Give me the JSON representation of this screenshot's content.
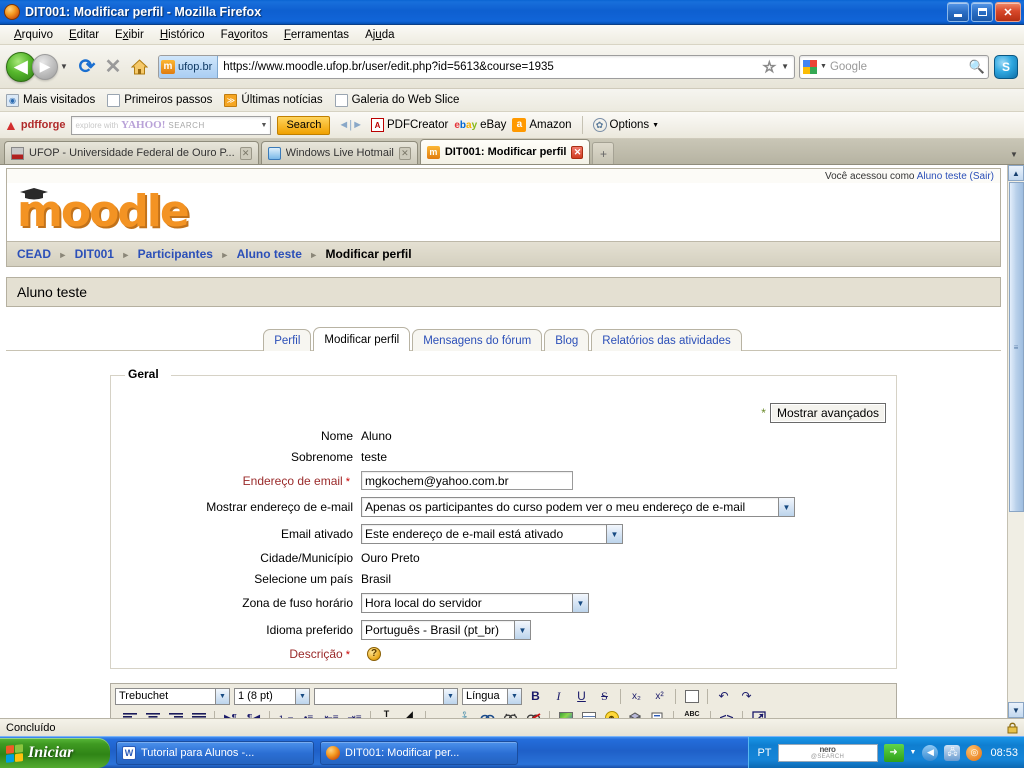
{
  "window": {
    "title": "DIT001: Modificar perfil - Mozilla Firefox",
    "minimize_label": "Minimizar",
    "maximize_label": "Restaurar",
    "close_label": "Fechar"
  },
  "menu": [
    {
      "label": "Arquivo"
    },
    {
      "label": "Editar"
    },
    {
      "label": "Exibir"
    },
    {
      "label": "Histórico"
    },
    {
      "label": "Favoritos"
    },
    {
      "label": "Ferramentas"
    },
    {
      "label": "Ajuda"
    }
  ],
  "nav": {
    "back_glyph": "◀",
    "forward_glyph": "▶",
    "reload_glyph": "⟳",
    "stop_glyph": "✕",
    "home_glyph": "🏠",
    "identity_domain": "ufop.br",
    "identity_badge_letter": "m",
    "url": "https://www.moodle.ufop.br/user/edit.php?id=5613&course=1935",
    "bookmark_star": "☆",
    "search_engine": "Google",
    "search_placeholder": "Google",
    "search_value": "",
    "magnify_glyph": "🔍",
    "skype_label": "S"
  },
  "bookmarks": [
    {
      "label": "Mais visitados",
      "icon": "globe-icon"
    },
    {
      "label": "Primeiros passos",
      "icon": "page-icon"
    },
    {
      "label": "Últimas notícias",
      "icon": "rss-icon"
    },
    {
      "label": "Galeria do Web Slice",
      "icon": "page-icon"
    }
  ],
  "addonbar": {
    "pdfforge_label": "pdfforge",
    "yahoo_hint": "explore with",
    "yahoo_brand": "YAHOO!",
    "yahoo_search_word": "SEARCH",
    "search_button": "Search",
    "items": [
      {
        "label": "PDFCreator",
        "icon": "pdf-icon"
      },
      {
        "label": "eBay",
        "icon": "ebay-icon"
      },
      {
        "label": "Amazon",
        "icon": "amazon-icon"
      }
    ],
    "options_label": "Options"
  },
  "tabs": [
    {
      "label": "UFOP - Universidade Federal de Ouro P...",
      "active": false,
      "icon": "ufop-icon"
    },
    {
      "label": "Windows Live Hotmail",
      "active": false,
      "icon": "hotmail-icon"
    },
    {
      "label": "DIT001: Modificar perfil",
      "active": true,
      "icon": "moodle-icon"
    }
  ],
  "newtab_glyph": "+",
  "page": {
    "login_info_prefix": "Você acessou como",
    "login_user": "Aluno teste",
    "login_logout": "(Sair)",
    "logo_text": "moodle",
    "breadcrumb": [
      {
        "label": "CEAD",
        "link": true
      },
      {
        "label": "DIT001",
        "link": true
      },
      {
        "label": "Participantes",
        "link": true
      },
      {
        "label": "Aluno teste",
        "link": true
      },
      {
        "label": "Modificar perfil",
        "link": false
      }
    ],
    "heading": "Aluno teste",
    "content_tabs": [
      {
        "label": "Perfil",
        "active": false
      },
      {
        "label": "Modificar perfil",
        "active": true
      },
      {
        "label": "Mensagens do fórum",
        "active": false
      },
      {
        "label": "Blog",
        "active": false
      },
      {
        "label": "Relatórios das atividades",
        "active": false
      }
    ],
    "form": {
      "legend": "Geral",
      "advanced_button": "Mostrar avançados",
      "advanced_star": "*",
      "fields": [
        {
          "label": "Nome",
          "required": false,
          "type": "static",
          "value": "Aluno"
        },
        {
          "label": "Sobrenome",
          "required": false,
          "type": "static",
          "value": "teste"
        },
        {
          "label": "Endereço de email",
          "required": true,
          "type": "text",
          "value": "mgkochem@yahoo.com.br"
        },
        {
          "label": "Mostrar endereço de e-mail",
          "required": false,
          "type": "select",
          "value": "Apenas os participantes do curso podem ver o meu endereço de e-mail"
        },
        {
          "label": "Email ativado",
          "required": false,
          "type": "select",
          "value": "Este endereço de e-mail está ativado"
        },
        {
          "label": "Cidade/Município",
          "required": false,
          "type": "static",
          "value": "Ouro Preto"
        },
        {
          "label": "Selecione um país",
          "required": false,
          "type": "static",
          "value": "Brasil"
        },
        {
          "label": "Zona de fuso horário",
          "required": false,
          "type": "select",
          "value": "Hora local do servidor"
        },
        {
          "label": "Idioma preferido",
          "required": false,
          "type": "select",
          "value": "Português - Brasil (pt_br)"
        },
        {
          "label": "Descrição",
          "required": true,
          "type": "help",
          "value": ""
        }
      ]
    },
    "editor": {
      "font_family": "Trebuchet",
      "font_size": "1 (8 pt)",
      "format": "",
      "language": "Língua",
      "row1_buttons": [
        {
          "name": "bold-button",
          "glyph": "B"
        },
        {
          "name": "italic-button",
          "glyph": "I"
        },
        {
          "name": "underline-button",
          "glyph": "U"
        },
        {
          "name": "strikethrough-button",
          "glyph": "S"
        },
        {
          "name": "subscript-button",
          "glyph": "x₂"
        },
        {
          "name": "superscript-button",
          "glyph": "x²"
        },
        {
          "name": "cleanup-html-button",
          "glyph": "▤"
        },
        {
          "name": "undo-button",
          "glyph": "↶"
        },
        {
          "name": "redo-button",
          "glyph": "↷"
        }
      ],
      "row2_buttons": [
        {
          "name": "align-left-button",
          "glyph": "≡"
        },
        {
          "name": "align-center-button",
          "glyph": "≡"
        },
        {
          "name": "align-right-button",
          "glyph": "≡"
        },
        {
          "name": "align-justify-button",
          "glyph": "≡"
        },
        {
          "name": "text-direction-ltr-button",
          "glyph": "▶¶"
        },
        {
          "name": "text-direction-rtl-button",
          "glyph": "¶◀"
        },
        {
          "name": "ordered-list-button",
          "glyph": "⒈≡"
        },
        {
          "name": "unordered-list-button",
          "glyph": "•≡"
        },
        {
          "name": "outdent-button",
          "glyph": "⇤≡"
        },
        {
          "name": "indent-button",
          "glyph": "⇥≡"
        },
        {
          "name": "font-color-button",
          "glyph": "T"
        },
        {
          "name": "background-color-button",
          "glyph": "◧"
        },
        {
          "name": "horizontal-rule-button",
          "glyph": "—"
        },
        {
          "name": "anchor-button",
          "glyph": "⚓"
        },
        {
          "name": "insert-link-button",
          "glyph": "🔗"
        },
        {
          "name": "unlink-button",
          "glyph": "⛓"
        },
        {
          "name": "remove-link-button",
          "glyph": "⛓"
        },
        {
          "name": "insert-image-button",
          "glyph": "▨"
        },
        {
          "name": "insert-table-button",
          "glyph": "▦"
        },
        {
          "name": "insert-emoticon-button",
          "glyph": "☺"
        },
        {
          "name": "insert-media-button",
          "glyph": "▣"
        },
        {
          "name": "paste-button",
          "glyph": "▤"
        },
        {
          "name": "spellcheck-button",
          "glyph": "ABC"
        },
        {
          "name": "html-source-button",
          "glyph": "<>"
        },
        {
          "name": "fullscreen-button",
          "glyph": "⤢"
        }
      ]
    }
  },
  "statusbar": {
    "text": "Concluído",
    "lock_icon": "lock-icon"
  },
  "taskbar": {
    "start_label": "Iniciar",
    "items": [
      {
        "label": "Tutorial para Alunos -...",
        "icon": "word-icon"
      },
      {
        "label": "DIT001: Modificar per...",
        "icon": "firefox-icon"
      }
    ],
    "tray": {
      "language": "PT",
      "nero_line1": "nero",
      "nero_line2": "@SEARCH",
      "go_glyph": "➜",
      "clock": "08:53"
    }
  },
  "colors": {
    "title_blue": "#0e5fd0",
    "moodle_orange": "#f39323",
    "link_blue": "#2b4fb8",
    "required_red": "#9a2a2a",
    "taskbar_blue": "#2b6fd4",
    "start_green": "#3f9a22"
  }
}
